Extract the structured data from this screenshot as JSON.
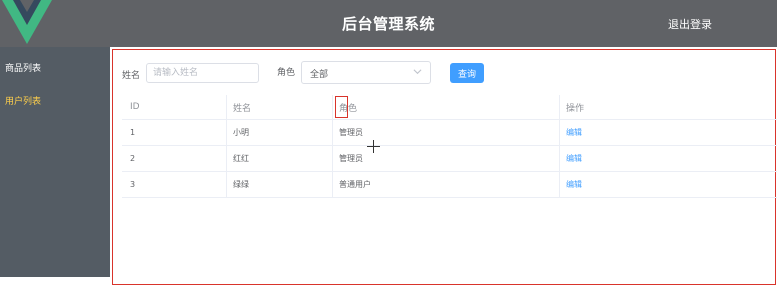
{
  "header": {
    "title": "后台管理系统",
    "logout_label": "退出登录",
    "logo_icon": "vue-logo-icon"
  },
  "sidebar": {
    "items": [
      {
        "label": "商品列表",
        "active": false
      },
      {
        "label": "用户列表",
        "active": true
      }
    ]
  },
  "search_form": {
    "name_label": "姓名",
    "name_placeholder": "请输入姓名",
    "name_value": "",
    "role_label": "角色",
    "role_value": "全部",
    "query_button": "查询"
  },
  "table": {
    "columns": [
      "ID",
      "姓名",
      "角色",
      "操作"
    ],
    "rows": [
      {
        "id": "1",
        "name": "小明",
        "role": "管理员",
        "action": "编辑"
      },
      {
        "id": "2",
        "name": "红红",
        "role": "管理员",
        "action": "编辑"
      },
      {
        "id": "3",
        "name": "绿绿",
        "role": "普通用户",
        "action": "编辑"
      }
    ]
  },
  "colors": {
    "header_bg": "#606266",
    "sidebar_bg": "#545c64",
    "active_menu": "#ffd04b",
    "primary": "#409eff",
    "highlight_border": "#d9342b"
  }
}
